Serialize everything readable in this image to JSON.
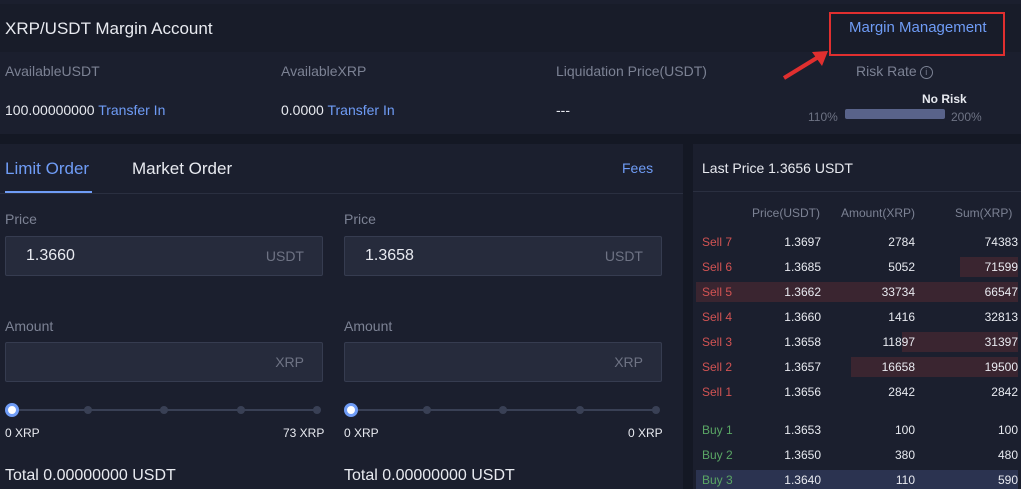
{
  "account": {
    "title": "XRP/USDT Margin Account",
    "margin_management": "Margin Management",
    "available_usdt_label": "AvailableUSDT",
    "available_usdt_value": "100.00000000",
    "available_xrp_label": "AvailableXRP",
    "available_xrp_value": "0.0000",
    "transfer_in": "Transfer In",
    "liquidation_label": "Liquidation Price(USDT)",
    "liquidation_value": "---",
    "risk_label": "Risk Rate",
    "risk_status": "No Risk",
    "risk_min": "110%",
    "risk_max": "200%",
    "risk_fill_fraction": 1.0,
    "info_icon": "i"
  },
  "form": {
    "tabs": [
      "Limit Order",
      "Market Order"
    ],
    "fees": "Fees",
    "buy": {
      "price_label": "Price",
      "price_value": "1.3660",
      "price_unit": "USDT",
      "amount_label": "Amount",
      "amount_unit": "XRP",
      "slider_min": "0 XRP",
      "slider_max": "73 XRP",
      "total": "Total 0.00000000 USDT"
    },
    "sell": {
      "price_label": "Price",
      "price_value": "1.3658",
      "price_unit": "USDT",
      "amount_label": "Amount",
      "amount_unit": "XRP",
      "slider_min": "0 XRP",
      "slider_max": "0 XRP",
      "total": "Total 0.00000000 USDT"
    }
  },
  "orderbook": {
    "last_price": "Last Price 1.3656 USDT",
    "columns": [
      "Price(USDT)",
      "Amount(XRP)",
      "Sum(XRP)"
    ],
    "rows": [
      {
        "label": "Sell 7",
        "side": "sell",
        "price": "1.3697",
        "amount": "2784",
        "sum": "74383",
        "depth": 0.0
      },
      {
        "label": "Sell 6",
        "side": "sell",
        "price": "1.3685",
        "amount": "5052",
        "sum": "71599",
        "depth": 0.18
      },
      {
        "label": "Sell 5",
        "side": "sell",
        "price": "1.3662",
        "amount": "33734",
        "sum": "66547",
        "depth": 1.0
      },
      {
        "label": "Sell 4",
        "side": "sell",
        "price": "1.3660",
        "amount": "1416",
        "sum": "32813",
        "depth": 0.0
      },
      {
        "label": "Sell 3",
        "side": "sell",
        "price": "1.3658",
        "amount": "11897",
        "sum": "31397",
        "depth": 0.36
      },
      {
        "label": "Sell 2",
        "side": "sell",
        "price": "1.3657",
        "amount": "16658",
        "sum": "19500",
        "depth": 0.52
      },
      {
        "label": "Sell 1",
        "side": "sell",
        "price": "1.3656",
        "amount": "2842",
        "sum": "2842",
        "depth": 0.0
      },
      {
        "label": "Buy 1",
        "side": "buy",
        "price": "1.3653",
        "amount": "100",
        "sum": "100",
        "depth": 0.0
      },
      {
        "label": "Buy 2",
        "side": "buy",
        "price": "1.3650",
        "amount": "380",
        "sum": "480",
        "depth": 0.0
      },
      {
        "label": "Buy 3",
        "side": "buy",
        "price": "1.3640",
        "amount": "110",
        "sum": "590",
        "depth": 1.0
      }
    ]
  }
}
